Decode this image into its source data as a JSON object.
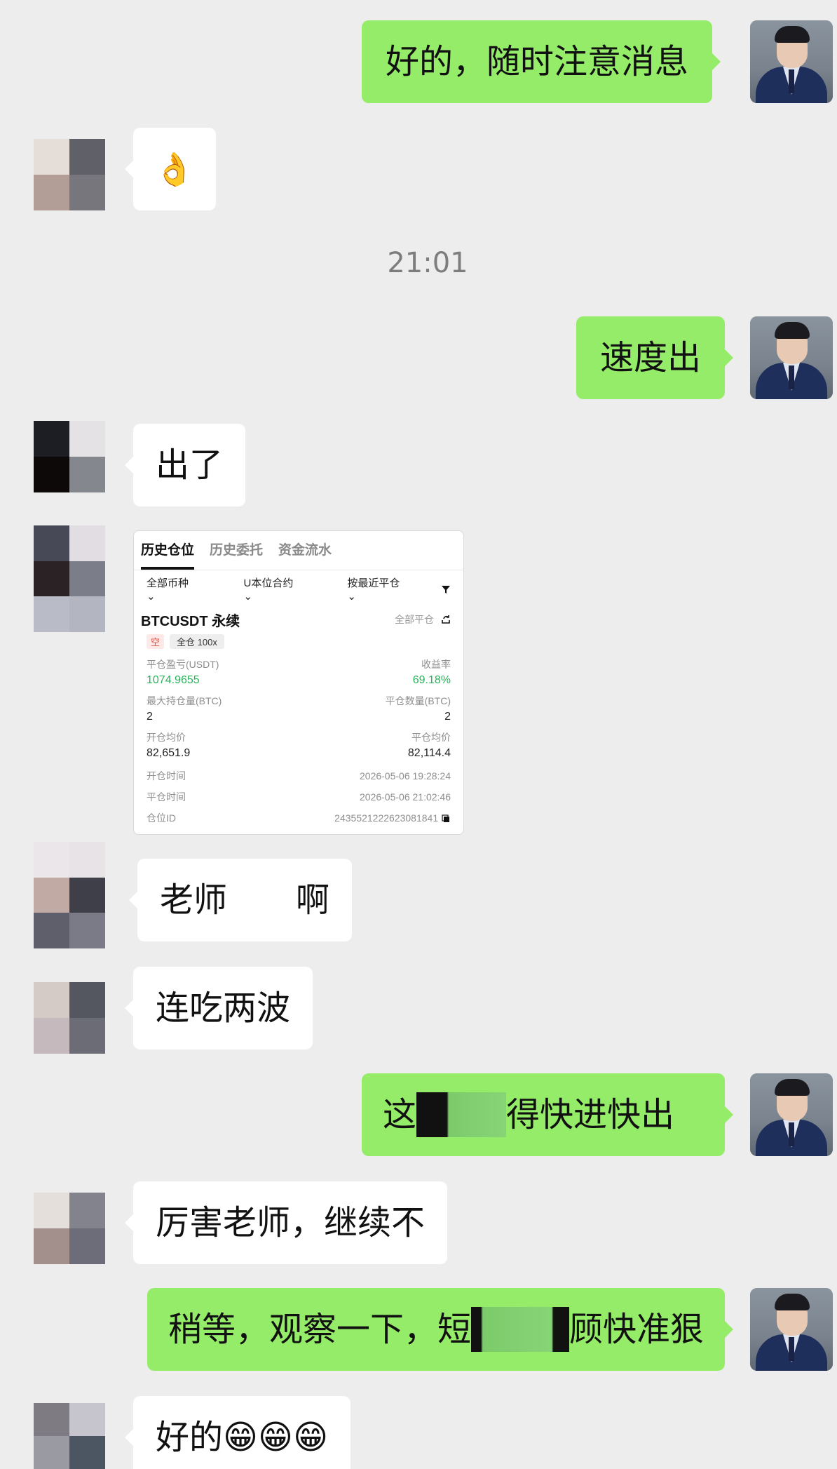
{
  "timestamp": "21:01",
  "messages": [
    {
      "side": "me",
      "text": "好的，随时注意消息"
    },
    {
      "side": "them",
      "text": "👌"
    },
    {
      "side": "me",
      "text": "速度出"
    },
    {
      "side": "them",
      "text": "出了"
    },
    {
      "side": "them",
      "text_visible_left": "老师",
      "text_visible_right": "啊"
    },
    {
      "side": "them",
      "text": "连吃两波"
    },
    {
      "side": "me",
      "text_visible_left": "这",
      "text_visible_right": "得快进快出"
    },
    {
      "side": "them",
      "text": "厉害老师，继续不"
    },
    {
      "side": "me",
      "text_visible_left": "稍等，观察一下，短",
      "text_visible_right": "顾快准狠"
    },
    {
      "side": "them",
      "text": "好的😁😁😁"
    }
  ],
  "trade_card": {
    "tabs": [
      "历史仓位",
      "历史委托",
      "资金流水"
    ],
    "filter_coin": "全部币种",
    "filter_contract": "U本位合约",
    "filter_sort": "按最近平仓",
    "symbol": "BTCUSDT 永续",
    "close_all": "全部平仓",
    "tag_side": "空",
    "tag_leverage": "全仓 100x",
    "pnl_label": "平仓盈亏(USDT)",
    "pnl_value": "1074.9655",
    "roi_label": "收益率",
    "roi_value": "69.18%",
    "max_hold_label": "最大持仓量(BTC)",
    "max_hold_value": "2",
    "close_qty_label": "平仓数量(BTC)",
    "close_qty_value": "2",
    "open_avg_label": "开仓均价",
    "open_avg_value": "82,651.9",
    "close_avg_label": "平仓均价",
    "close_avg_value": "82,114.4",
    "open_time_label": "开仓时间",
    "open_time_value": "2026-05-06 19:28:24",
    "close_time_label": "平仓时间",
    "close_time_value": "2026-05-06 21:02:46",
    "position_id_label": "仓位ID",
    "position_id_value": "2435521222623081841"
  }
}
